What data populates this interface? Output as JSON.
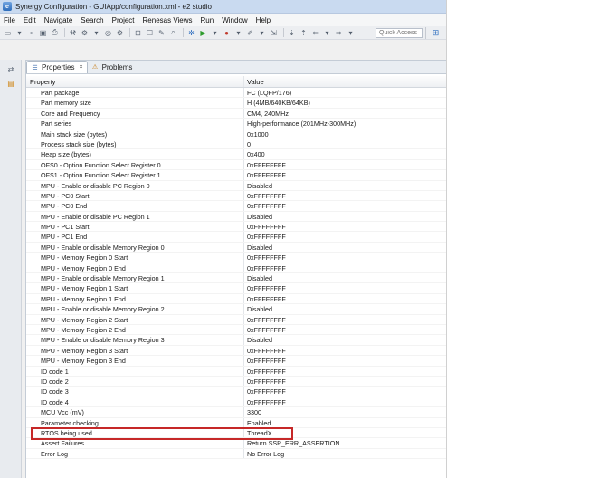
{
  "window": {
    "title": "Synergy Configuration - GUIApp/configuration.xml - e2 studio"
  },
  "menu": [
    "File",
    "Edit",
    "Navigate",
    "Search",
    "Project",
    "Renesas Views",
    "Run",
    "Window",
    "Help"
  ],
  "toolbar": {
    "quick_access": "Quick Access"
  },
  "tabs": [
    {
      "label": "Properties",
      "close": "×"
    },
    {
      "label": "Problems"
    }
  ],
  "table": {
    "header_property": "Property",
    "header_value": "Value",
    "rows": [
      {
        "property": "Part package",
        "value": "FC (LQFP/176)"
      },
      {
        "property": "Part memory size",
        "value": "H (4MB/640KB/64KB)"
      },
      {
        "property": "Core and Frequency",
        "value": "CM4, 240MHz"
      },
      {
        "property": "Part series",
        "value": "High-performance (201MHz-300MHz)"
      },
      {
        "property": "Main stack size (bytes)",
        "value": "0x1000"
      },
      {
        "property": "Process stack size (bytes)",
        "value": "0"
      },
      {
        "property": "Heap size (bytes)",
        "value": "0x400"
      },
      {
        "property": "OFS0 - Option Function Select Register 0",
        "value": "0xFFFFFFFF"
      },
      {
        "property": "OFS1 - Option Function Select Register 1",
        "value": "0xFFFFFFFF"
      },
      {
        "property": "MPU - Enable or disable PC Region 0",
        "value": "Disabled"
      },
      {
        "property": "MPU - PC0 Start",
        "value": "0xFFFFFFFF"
      },
      {
        "property": "MPU - PC0 End",
        "value": "0xFFFFFFFF"
      },
      {
        "property": "MPU - Enable or disable PC Region 1",
        "value": "Disabled"
      },
      {
        "property": "MPU - PC1 Start",
        "value": "0xFFFFFFFF"
      },
      {
        "property": "MPU - PC1 End",
        "value": "0xFFFFFFFF"
      },
      {
        "property": "MPU - Enable or disable Memory Region 0",
        "value": "Disabled"
      },
      {
        "property": "MPU - Memory Region 0 Start",
        "value": "0xFFFFFFFF"
      },
      {
        "property": "MPU - Memory Region 0 End",
        "value": "0xFFFFFFFF"
      },
      {
        "property": "MPU - Enable or disable Memory Region 1",
        "value": "Disabled"
      },
      {
        "property": "MPU - Memory Region 1 Start",
        "value": "0xFFFFFFFF"
      },
      {
        "property": "MPU - Memory Region 1 End",
        "value": "0xFFFFFFFF"
      },
      {
        "property": "MPU - Enable or disable Memory Region 2",
        "value": "Disabled"
      },
      {
        "property": "MPU - Memory Region 2 Start",
        "value": "0xFFFFFFFF"
      },
      {
        "property": "MPU - Memory Region 2 End",
        "value": "0xFFFFFFFF"
      },
      {
        "property": "MPU - Enable or disable Memory Region 3",
        "value": "Disabled"
      },
      {
        "property": "MPU - Memory Region 3 Start",
        "value": "0xFFFFFFFF"
      },
      {
        "property": "MPU - Memory Region 3 End",
        "value": "0xFFFFFFFF"
      },
      {
        "property": "ID code 1",
        "value": "0xFFFFFFFF"
      },
      {
        "property": "ID code 2",
        "value": "0xFFFFFFFF"
      },
      {
        "property": "ID code 3",
        "value": "0xFFFFFFFF"
      },
      {
        "property": "ID code 4",
        "value": "0xFFFFFFFF"
      },
      {
        "property": "MCU Vcc (mV)",
        "value": "3300"
      },
      {
        "property": "Parameter checking",
        "value": "Enabled"
      },
      {
        "property": "RTOS being used",
        "value": "ThreadX"
      },
      {
        "property": "Assert Failures",
        "value": "Return SSP_ERR_ASSERTION"
      },
      {
        "property": "Error Log",
        "value": "No Error Log"
      }
    ]
  },
  "colors": {
    "highlight": "#c62828"
  }
}
